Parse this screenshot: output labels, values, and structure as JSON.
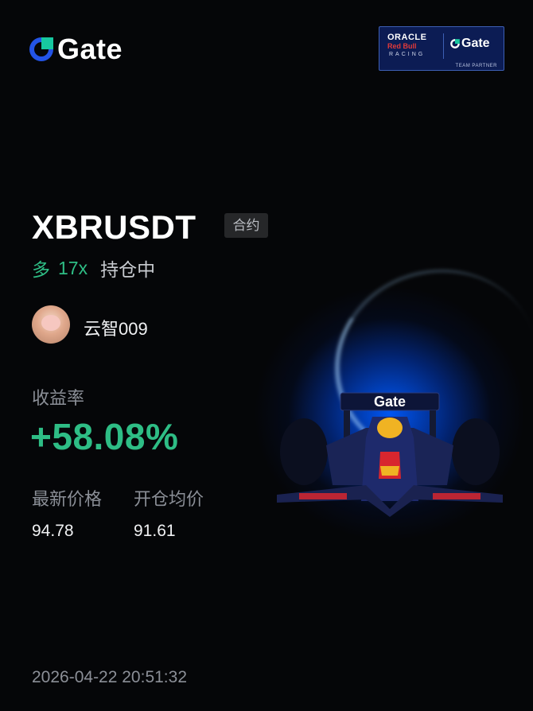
{
  "brand": {
    "name": "Gate",
    "accent": "#2354e6"
  },
  "partner_badge": {
    "oracle": "ORACLE",
    "redbull": "Red Bull",
    "racing": "RACING",
    "gate": "Gate",
    "caption": "TEAM PARTNER"
  },
  "position": {
    "symbol": "XBRUSDT",
    "type_tag": "合约",
    "direction": "多",
    "leverage": "17x",
    "status": "持仓中"
  },
  "user": {
    "name": "云智009"
  },
  "stats": {
    "roi_label": "收益率",
    "roi_value": "+58.08%",
    "last_price_label": "最新价格",
    "last_price_value": "94.78",
    "entry_price_label": "开仓均价",
    "entry_price_value": "91.61"
  },
  "timestamp": "2026-04-22 20:51:32",
  "colors": {
    "positive": "#2ebd85",
    "muted": "#8b8f97",
    "background": "#050608"
  },
  "car_livery_text": "Gate"
}
